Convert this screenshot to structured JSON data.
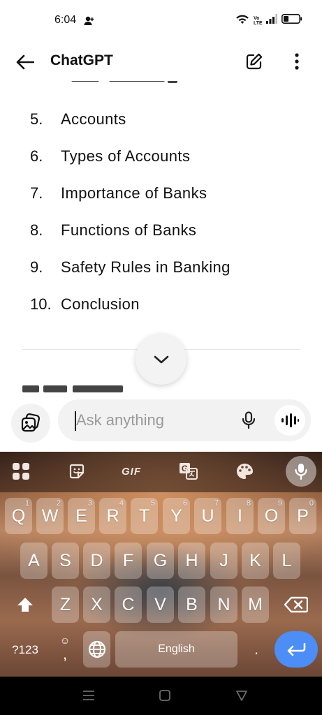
{
  "status_bar": {
    "time": "6:04",
    "network_label": "Vo LTE"
  },
  "app_bar": {
    "title": "ChatGPT"
  },
  "conversation": {
    "list_items": [
      {
        "number": "5.",
        "text": "Accounts"
      },
      {
        "number": "6.",
        "text": "Types of Accounts"
      },
      {
        "number": "7.",
        "text": "Importance of Banks"
      },
      {
        "number": "8.",
        "text": "Functions of Banks"
      },
      {
        "number": "9.",
        "text": "Safety Rules in Banking"
      },
      {
        "number": "10.",
        "text": "Conclusion"
      }
    ]
  },
  "composer": {
    "placeholder": "Ask anything"
  },
  "keyboard": {
    "toolbar": {
      "gif_label": "GIF"
    },
    "row1": [
      {
        "key": "Q",
        "hint": "1"
      },
      {
        "key": "W",
        "hint": "2"
      },
      {
        "key": "E",
        "hint": "3"
      },
      {
        "key": "R",
        "hint": "4"
      },
      {
        "key": "T",
        "hint": "5"
      },
      {
        "key": "Y",
        "hint": "6"
      },
      {
        "key": "U",
        "hint": "7"
      },
      {
        "key": "I",
        "hint": "8"
      },
      {
        "key": "O",
        "hint": "9"
      },
      {
        "key": "P",
        "hint": "0"
      }
    ],
    "row2": [
      "A",
      "S",
      "D",
      "F",
      "G",
      "H",
      "J",
      "K",
      "L"
    ],
    "row3": [
      "Z",
      "X",
      "C",
      "V",
      "B",
      "N",
      "M"
    ],
    "symbols_label": "?123",
    "comma": ",",
    "space_label": "English",
    "period": "."
  }
}
